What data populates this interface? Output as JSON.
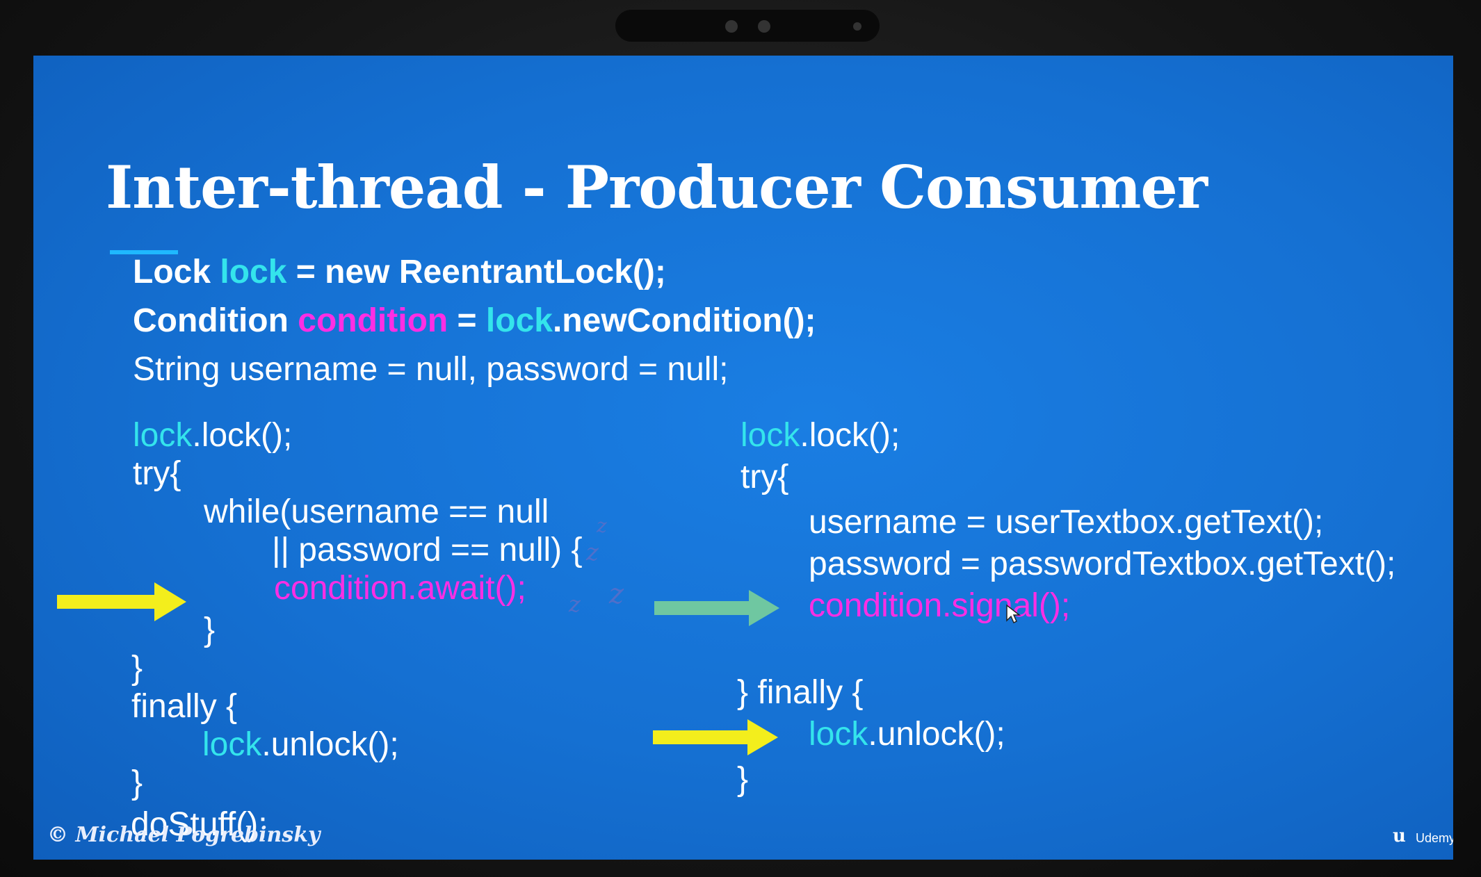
{
  "slide": {
    "title": "Inter-thread - Producer Consumer",
    "declarations": {
      "line1": {
        "a": "Lock ",
        "b": "lock",
        "c": " = new ReentrantLock();"
      },
      "line2": {
        "a": "Condition ",
        "b": "condition",
        "c": "  = ",
        "d": "lock",
        "e": ".newCondition();"
      },
      "line3": "String username = null, password = null;"
    },
    "consumer": {
      "l1": {
        "a": "lock",
        "b": ".lock();"
      },
      "l2": "try{",
      "l3": "while(username == null",
      "l4": "|| password == null) {",
      "l5": "condition.await();",
      "l6": "}",
      "l7": "}",
      "l8": "finally {",
      "l9": {
        "a": "lock",
        "b": ".unlock();"
      },
      "l10": "}",
      "l11": "doStuff();",
      "sleep_glyphs": [
        "z",
        "z",
        "z",
        "z"
      ]
    },
    "producer": {
      "l1": {
        "a": "lock",
        "b": ".lock();"
      },
      "l2": "try{",
      "l3": "username = userTextbox.getText();",
      "l4": "password = passwordTextbox.getText();",
      "l5": "condition.signal();",
      "l6": "} finally {",
      "l7": {
        "a": "lock",
        "b": ".unlock();"
      },
      "l8": "}"
    },
    "footer": {
      "copyright": "© Michael Pogrebinsky",
      "brand_mark": "u",
      "brand_name": "Udemy"
    }
  },
  "colors": {
    "slide_background": "#1570d2",
    "keyword_lock": "#34e4ec",
    "keyword_condition": "#ff2ee4",
    "arrow_yellow": "#f3ee1c",
    "arrow_green": "#6fc7a1",
    "text": "#ffffff"
  },
  "icons": [
    "arrow-right-yellow-icon",
    "arrow-right-green-icon",
    "mouse-cursor-icon",
    "udemy-logo-icon"
  ]
}
